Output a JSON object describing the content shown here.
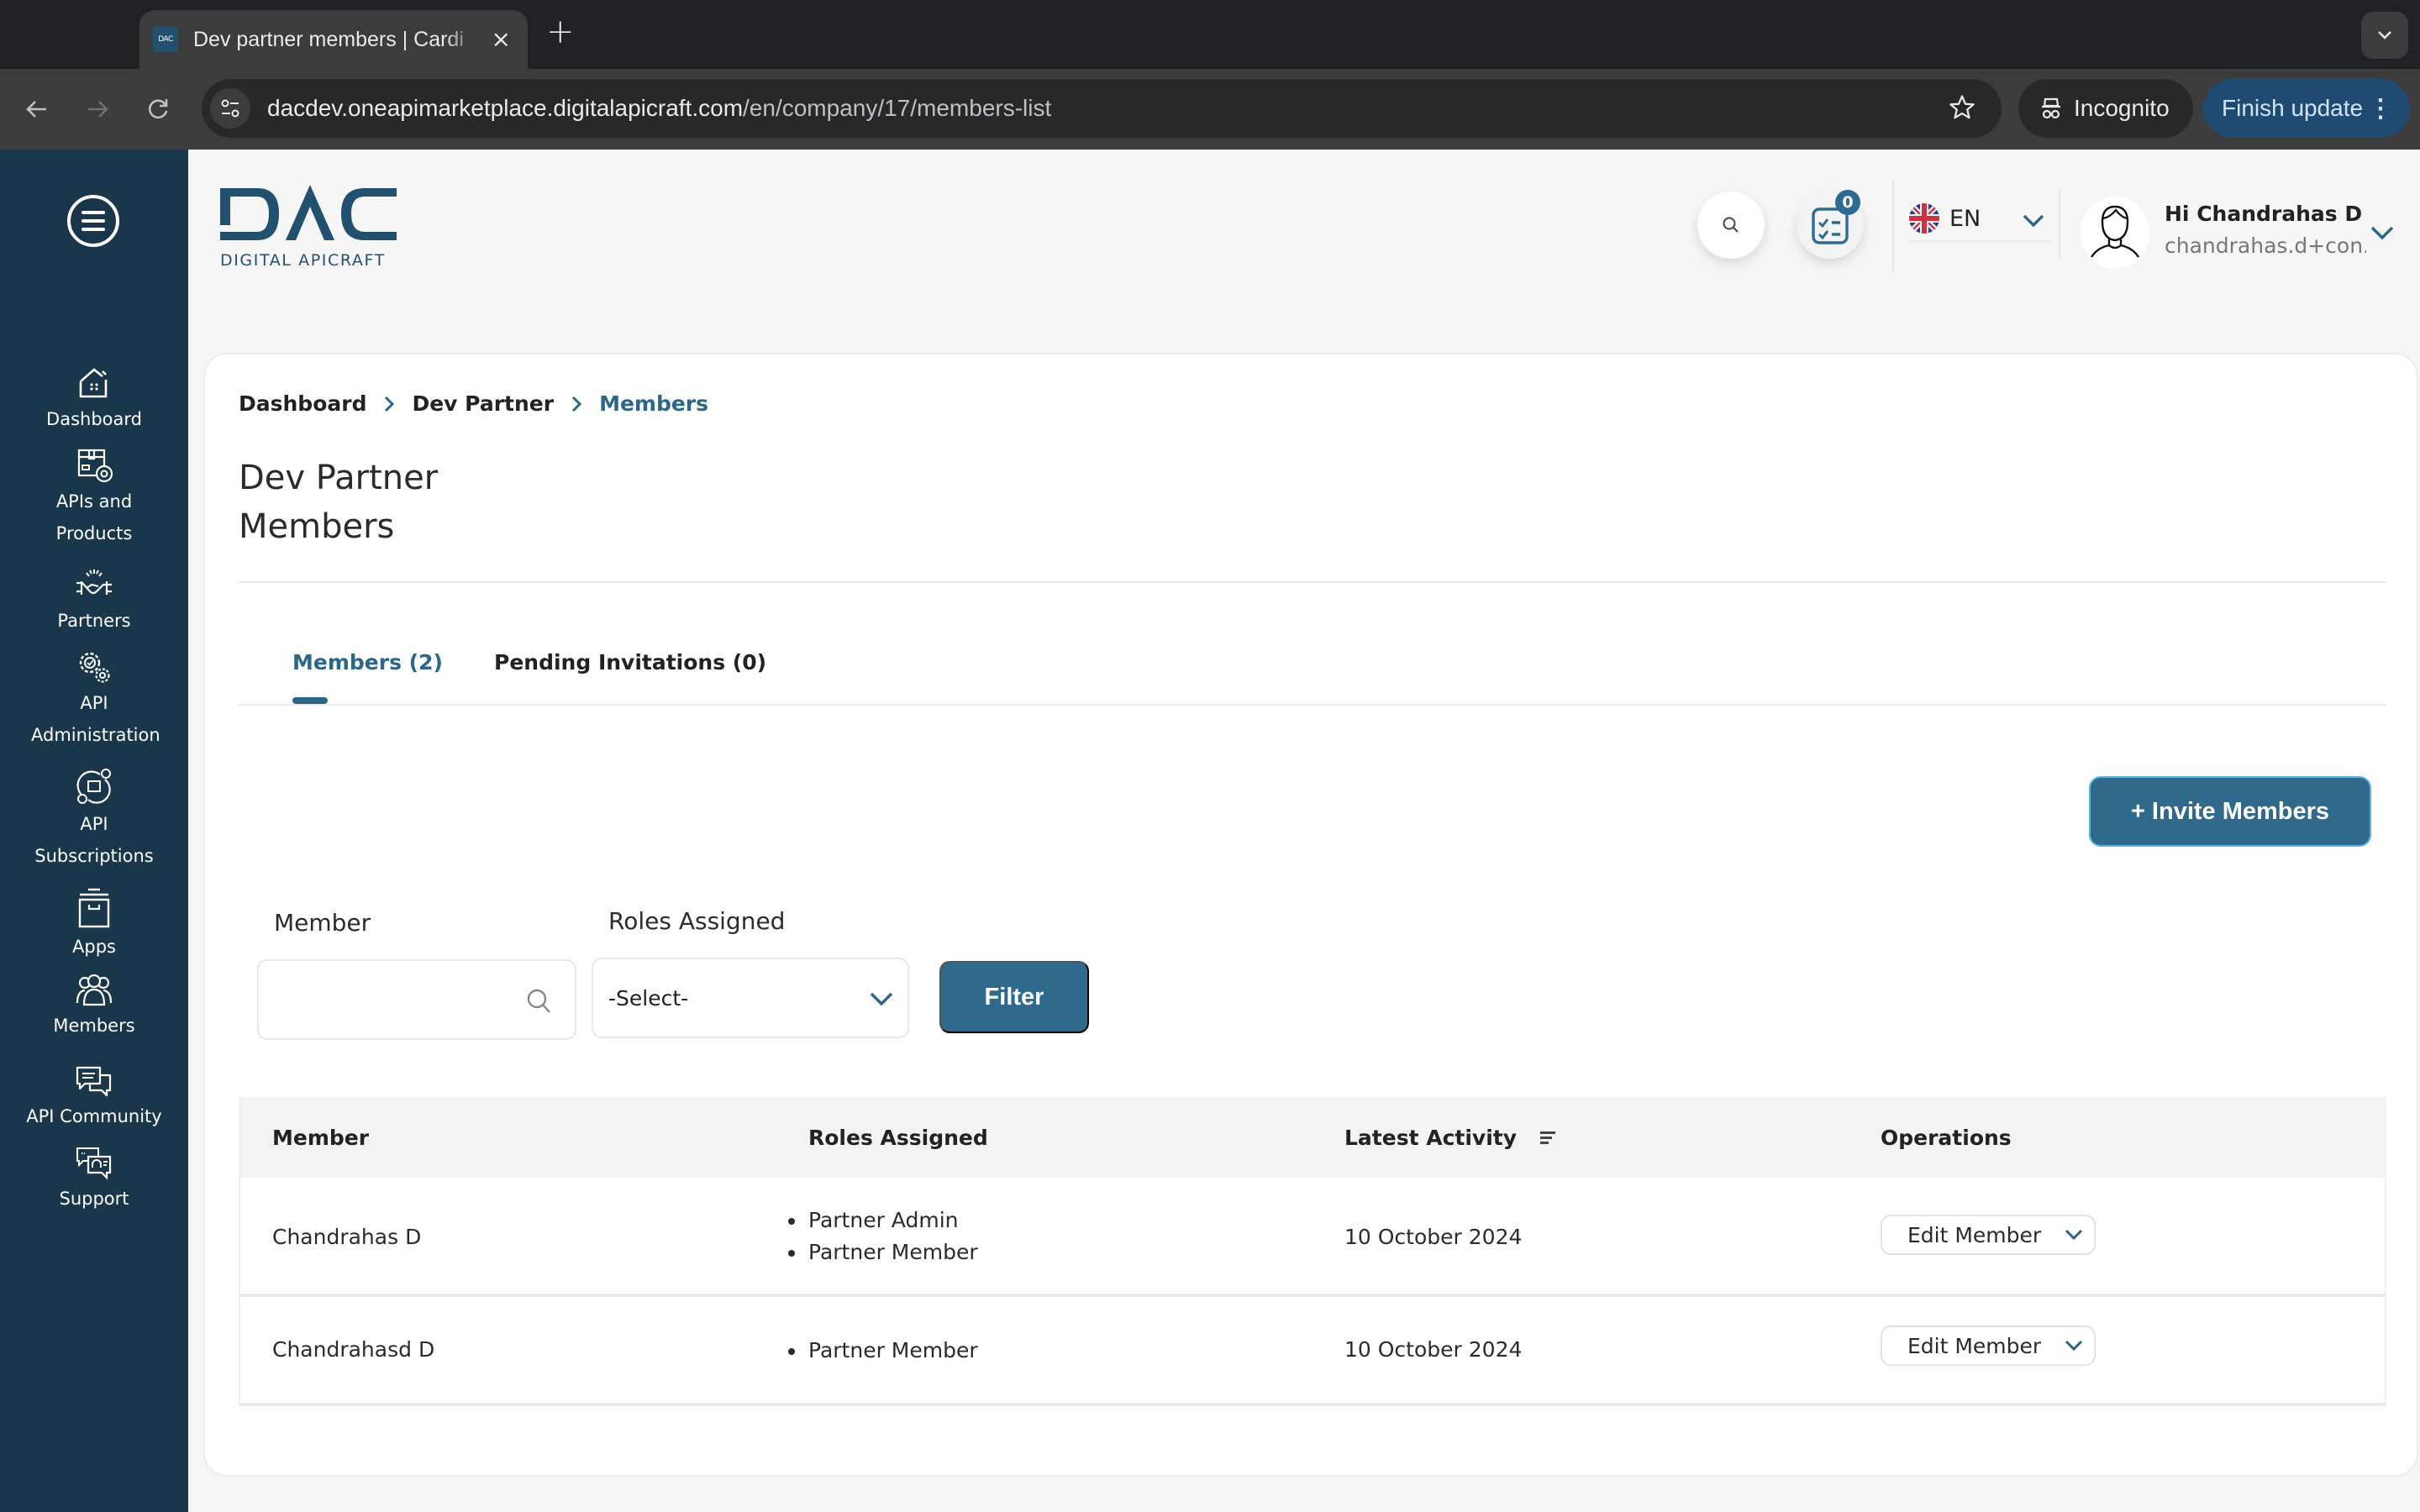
{
  "browser": {
    "tab_title": "Dev partner members | Cardi",
    "favicon_text": "DAC",
    "url_host": "dacdev.oneapimarketplace.digitalapicraft.com",
    "url_path": "/en/company/17/members-list",
    "incognito_label": "Incognito",
    "finish_update_label": "Finish update"
  },
  "sidebar": {
    "items": [
      {
        "label": "Dashboard",
        "icon": "home-icon"
      },
      {
        "label": "APIs and Products",
        "icon": "api-products-icon"
      },
      {
        "label": "Partners",
        "icon": "handshake-icon"
      },
      {
        "label": "API Administration",
        "icon": "gears-icon"
      },
      {
        "label": "API Subscriptions",
        "icon": "subscriptions-icon"
      },
      {
        "label": "Apps",
        "icon": "archive-box-icon"
      },
      {
        "label": "Members",
        "icon": "members-group-icon"
      },
      {
        "label": "API Community",
        "icon": "chat-bubbles-icon"
      },
      {
        "label": "Support",
        "icon": "support-chat-icon"
      }
    ]
  },
  "header": {
    "logo_main": "DAC",
    "logo_sub": "DIGITAL APICRAFT",
    "todo_badge": "0",
    "language": "EN",
    "greeting": "Hi Chandrahas D",
    "email": "chandrahas.d+con..."
  },
  "breadcrumb": {
    "items": [
      "Dashboard",
      "Dev Partner",
      "Members"
    ]
  },
  "page": {
    "title_line1": "Dev Partner",
    "title_line2": "Members"
  },
  "tabs": [
    {
      "label": "Members (2)",
      "active": true
    },
    {
      "label": "Pending Invitations (0)",
      "active": false
    }
  ],
  "actions": {
    "invite_label": "+ Invite Members"
  },
  "filters": {
    "member_label": "Member",
    "member_value": "",
    "roles_label": "Roles Assigned",
    "roles_selected": "-Select-",
    "filter_label": "Filter"
  },
  "table": {
    "columns": [
      "Member",
      "Roles Assigned",
      "Latest Activity",
      "Operations"
    ],
    "rows": [
      {
        "member": "Chandrahas D",
        "roles": [
          "Partner Admin",
          "Partner Member"
        ],
        "latest_activity": "10 October 2024",
        "operation": "Edit Member"
      },
      {
        "member": "Chandrahasd D",
        "roles": [
          "Partner Member"
        ],
        "latest_activity": "10 October 2024",
        "operation": "Edit Member"
      }
    ]
  },
  "colors": {
    "sidebar_bg": "#19364b",
    "accent": "#2f6a8d",
    "active_text": "#2c6688"
  }
}
